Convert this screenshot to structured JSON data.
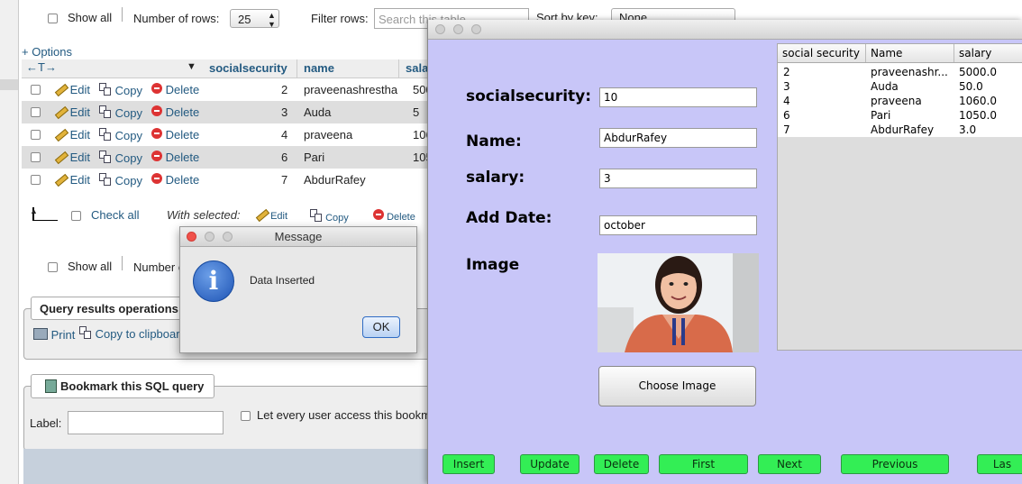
{
  "pma": {
    "show_all": "Show all",
    "number_of_rows_label": "Number of rows:",
    "number_of_rows_value": "25",
    "filter_rows_label": "Filter rows:",
    "filter_placeholder": "Search this table",
    "sort_by_key_label": "Sort by key:",
    "sort_by_key_value": "None",
    "options_link": "+ Options",
    "columns": [
      "socialsecurity",
      "name",
      "sala"
    ],
    "edit_label": "Edit",
    "copy_label": "Copy",
    "delete_label": "Delete",
    "rows": [
      {
        "socialsecurity": "2",
        "name": "praveenashrestha",
        "salary": "500"
      },
      {
        "socialsecurity": "3",
        "name": "Auda",
        "salary": "5"
      },
      {
        "socialsecurity": "4",
        "name": "praveena",
        "salary": "106"
      },
      {
        "socialsecurity": "6",
        "name": "Pari",
        "salary": "105"
      },
      {
        "socialsecurity": "7",
        "name": "AbdurRafey",
        "salary": ""
      }
    ],
    "check_all": "Check all",
    "with_selected": "With selected:",
    "bottom_show_all": "Show all",
    "bottom_number_of_rows": "Number of",
    "query_results_ops": "Query results operations",
    "print_label": "Print",
    "copy_clipboard_label": "Copy to clipboar",
    "bookmark_button": "Bookmark this SQL query",
    "label_field": "Label:",
    "let_every_user": "Let every user access this bookm"
  },
  "app": {
    "fields": [
      {
        "label": "socialsecurity:",
        "value": "10"
      },
      {
        "label": "Name:",
        "value": "AbdurRafey"
      },
      {
        "label": "salary:",
        "value": "3"
      },
      {
        "label": "Add Date:",
        "value": "october"
      }
    ],
    "image_label": "Image",
    "choose_image": "Choose Image",
    "table": {
      "headers": [
        "social security",
        "Name",
        "salary"
      ],
      "rows": [
        [
          "2",
          "praveenashr...",
          "5000.0"
        ],
        [
          "3",
          "Auda",
          "50.0"
        ],
        [
          "4",
          "praveena",
          "1060.0"
        ],
        [
          "6",
          "Pari",
          "1050.0"
        ],
        [
          "7",
          "AbdurRafey",
          "3.0"
        ]
      ]
    },
    "buttons": [
      "Insert",
      "Update",
      "Delete",
      "First",
      "Next",
      "Previous",
      "Las"
    ]
  },
  "dialog": {
    "title": "Message",
    "message": "Data Inserted",
    "ok": "OK"
  },
  "colors": {
    "app_bg": "#c8c6f8",
    "button_green": "#33ee55",
    "pma_link": "#235a81"
  }
}
